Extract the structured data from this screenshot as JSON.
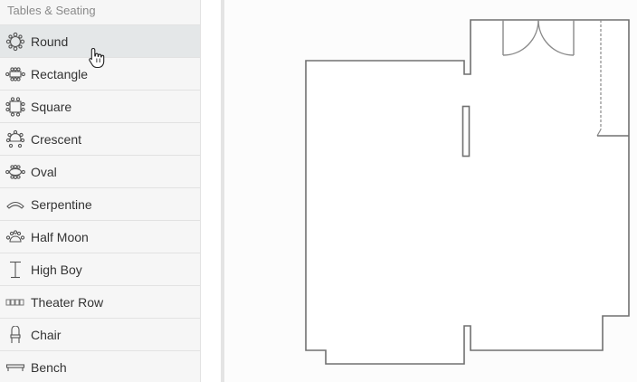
{
  "sidebar": {
    "section_title": "Tables & Seating",
    "items": [
      {
        "label": "Round",
        "icon": "round-table-icon"
      },
      {
        "label": "Rectangle",
        "icon": "rectangle-table-icon"
      },
      {
        "label": "Square",
        "icon": "square-table-icon"
      },
      {
        "label": "Crescent",
        "icon": "crescent-table-icon"
      },
      {
        "label": "Oval",
        "icon": "oval-table-icon"
      },
      {
        "label": "Serpentine",
        "icon": "serpentine-table-icon"
      },
      {
        "label": "Half Moon",
        "icon": "half-moon-table-icon"
      },
      {
        "label": "High Boy",
        "icon": "high-boy-table-icon"
      },
      {
        "label": "Theater Row",
        "icon": "theater-row-icon"
      },
      {
        "label": "Chair",
        "icon": "chair-icon"
      },
      {
        "label": "Bench",
        "icon": "bench-icon"
      }
    ],
    "active_item": "Round"
  },
  "colors": {
    "sidebar_bg": "#f6f6f6",
    "active_item_bg": "#e4e7e8",
    "canvas_bg": "#fcfcfc",
    "wall_stroke": "#707070",
    "text": "#333333",
    "section_title_text": "#8a8a8a"
  },
  "cursor": "hand-pointer-icon"
}
